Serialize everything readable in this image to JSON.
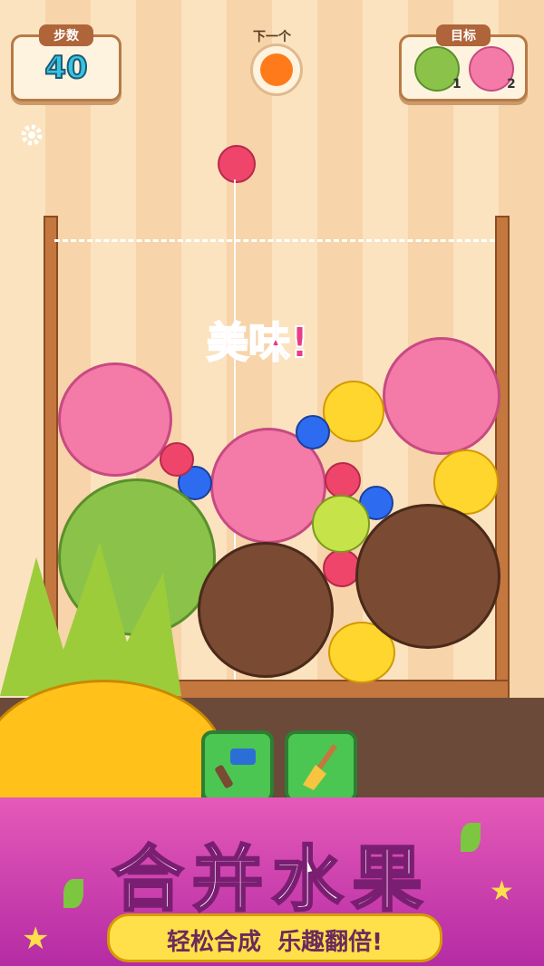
{
  "hud": {
    "steps_label": "步数",
    "steps_value": "40",
    "next_label": "下一个",
    "next_fruit": "orange",
    "goal_label": "目标",
    "goals": [
      {
        "fruit": "melon",
        "count": "1"
      },
      {
        "fruit": "peach",
        "count": "2"
      }
    ]
  },
  "icons": {
    "settings": "gear-icon"
  },
  "game": {
    "current_fruit": "raspberry",
    "combo_text": "美味!"
  },
  "tools": [
    {
      "name": "hammer",
      "icon": "hammer-icon"
    },
    {
      "name": "broom",
      "icon": "broom-icon"
    }
  ],
  "banner": {
    "title": "合并水果",
    "subtitle": "轻松合成  乐趣翻倍!"
  },
  "colors": {
    "accent": "#c9309f",
    "brown": "#b0643a",
    "peach": "#f47aa8",
    "melon": "#8bc34a"
  }
}
